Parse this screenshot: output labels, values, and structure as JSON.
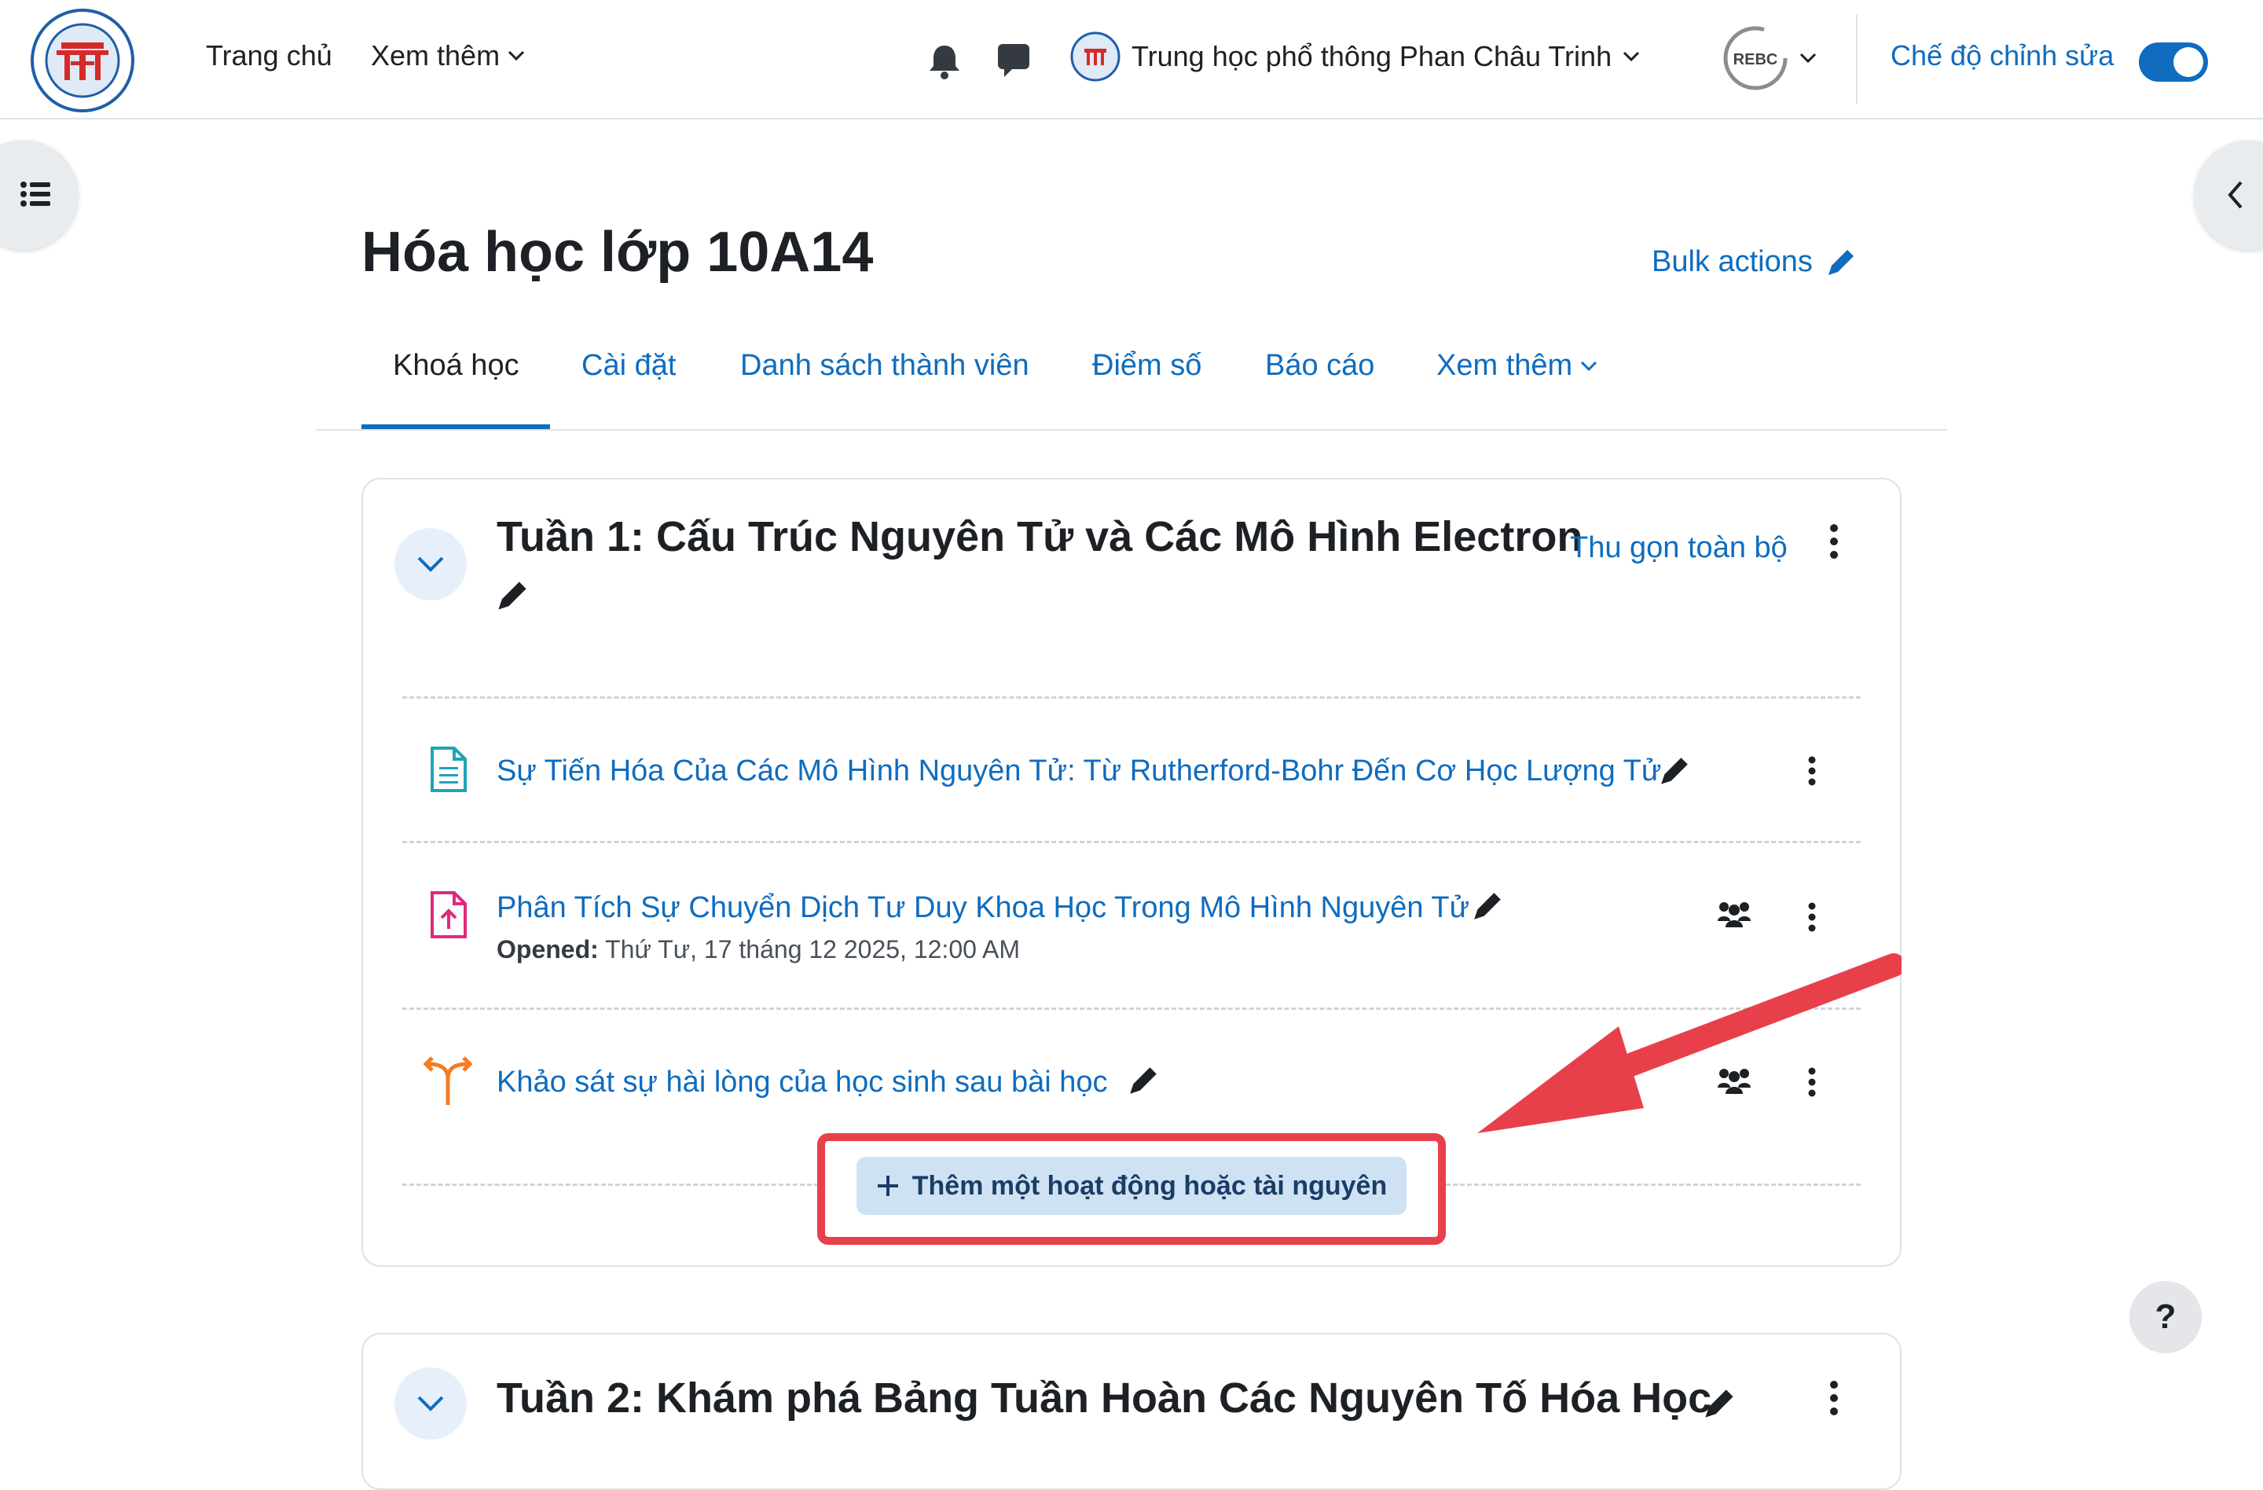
{
  "navbar": {
    "home": "Trang chủ",
    "more": "Xem thêm",
    "school": "Trung học phổ thông Phan Châu Trinh",
    "user_initials": "REBC",
    "edit_mode_label": "Chế độ chỉnh sửa",
    "edit_mode_on": true
  },
  "course": {
    "title": "Hóa học lớp 10A14",
    "bulk_actions": "Bulk actions"
  },
  "tabs": [
    {
      "label": "Khoá học",
      "active": true
    },
    {
      "label": "Cài đặt"
    },
    {
      "label": "Danh sách thành viên"
    },
    {
      "label": "Điểm số"
    },
    {
      "label": "Báo cáo"
    },
    {
      "label": "Xem thêm"
    }
  ],
  "sections": [
    {
      "title": "Tuần 1: Cấu Trúc Nguyên Tử và Các Mô Hình Electron",
      "collapse_all": "Thu gọn toàn bộ",
      "activities": [
        {
          "title": "Sự Tiến Hóa Của Các Mô Hình Nguyên Tử: Từ Rutherford-Bohr Đến Cơ Học Lượng Tử",
          "icon": "page-icon"
        },
        {
          "title": "Phân Tích Sự Chuyển Dịch Tư Duy Khoa Học Trong Mô Hình Nguyên Tử",
          "icon": "assignment-icon",
          "opened_label": "Opened:",
          "opened_value": "Thứ Tư, 17 tháng 12 2025, 12:00 AM"
        },
        {
          "title": "Khảo sát sự hài lòng của học sinh sau bài học",
          "icon": "choice-icon"
        }
      ],
      "add_activity": "Thêm một hoạt động hoặc tài nguyên"
    },
    {
      "title": "Tuần 2: Khám phá Bảng Tuần Hoàn Các Nguyên Tố Hóa Học"
    }
  ],
  "help": "?",
  "colors": {
    "accent": "#0f6cbf",
    "annotation": "#e8404a"
  }
}
